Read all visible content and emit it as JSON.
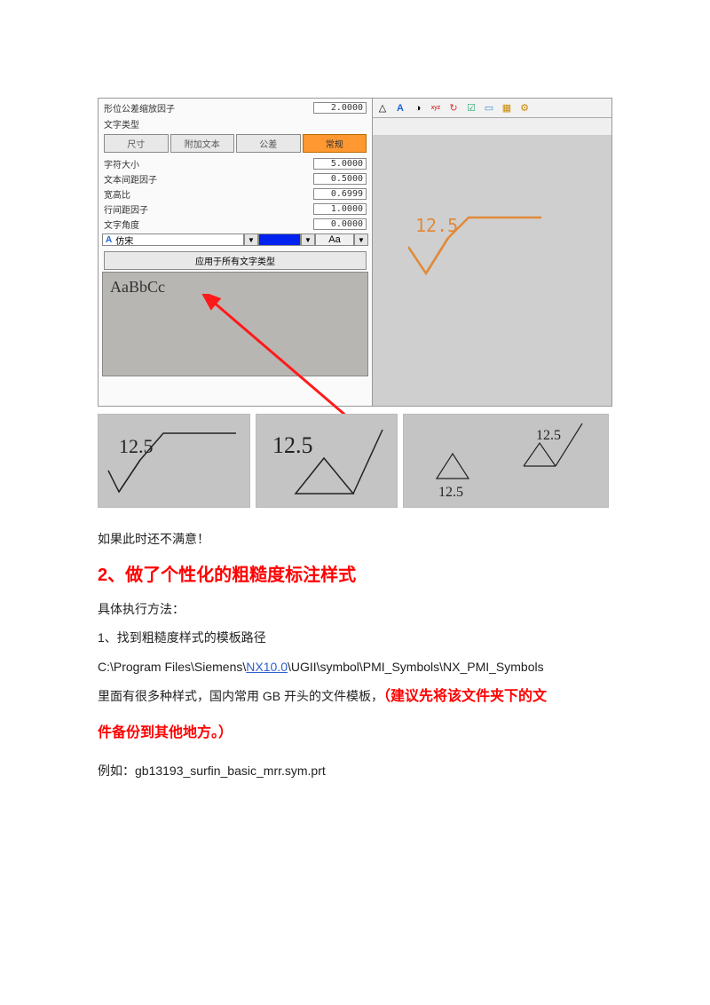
{
  "panel": {
    "top_field_label": "形位公差缩放因子",
    "top_field_val": "2.0000",
    "section_label": "文字类型",
    "tabs": {
      "t1": "尺寸",
      "t2": "附加文本",
      "t3": "公差",
      "t4": "常规"
    },
    "rows": {
      "r1_label": "字符大小",
      "r1_val": "5.0000",
      "r2_label": "文本间距因子",
      "r2_val": "0.5000",
      "r3_label": "宽高比",
      "r3_val": "0.6999",
      "r4_label": "行间距因子",
      "r4_val": "1.0000",
      "r5_label": "文字角度",
      "r5_val": "0.0000"
    },
    "font_prefix": "A",
    "font_name": "仿宋",
    "aa_label": "Aa",
    "apply_all": "应用于所有文字类型",
    "preview_sample": "AaBbCc"
  },
  "viewport": {
    "rough_value": "12.5"
  },
  "thumbs": {
    "v": "12.5"
  },
  "article": {
    "p1": "如果此时还不满意！",
    "h2": "2、做了个性化的粗糙度标注样式",
    "p2": "具体执行方法：",
    "p3": "1、找到粗糙度样式的模板路径",
    "path_pre": "C:\\Program Files\\Siemens\\",
    "path_link": "NX10.0",
    "path_post": "\\UGII\\symbol\\PMI_Symbols\\NX_PMI_Symbols",
    "p5a": "里面有很多种样式，国内常用 GB 开头的文件模板，",
    "p5b": "（建议先将该文件夹下的文",
    "p5c": "件备份到其他地方。）",
    "p6": "例如：gb13193_surfin_basic_mrr.sym.prt"
  }
}
